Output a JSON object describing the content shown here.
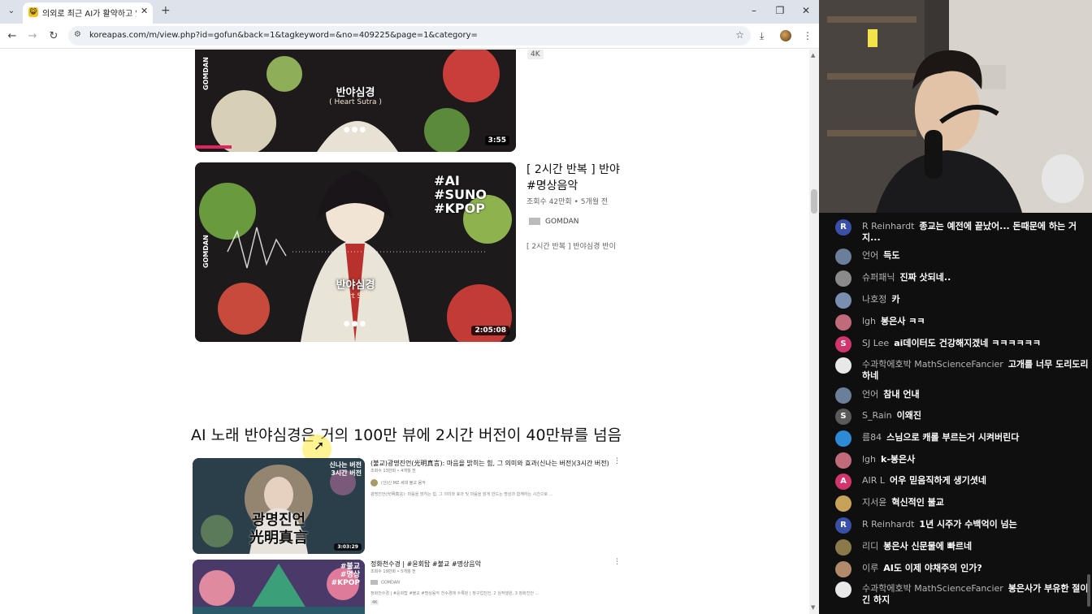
{
  "browser": {
    "tab_title": "의외로 최근 AI가 활약하고 있다",
    "url": "koreapas.com/m/view.php?id=gofun&back=1&tagkeyword=&no=409225&page=1&category="
  },
  "videos": [
    {
      "badge": "4K",
      "art_title": "반야심경",
      "art_sub": "( Heart Sutra )",
      "duration": "3:55"
    },
    {
      "art_title": "반야심경",
      "art_sub": "( Heart Sutra )",
      "hashtags": [
        "#AI",
        "#SUNO",
        "#KPOP"
      ],
      "duration": "2:05:08",
      "title_line1": "[ 2시간 반복 ] 반야",
      "title_line2": "#명상음악",
      "meta": "조회수 42만회 • 5개월 전",
      "channel": "GOMDAN",
      "desc": "[ 2시간 반복 ] 반야심경 반이"
    }
  ],
  "watermark": "GOMDAN",
  "headline": "AI 노래 반야심경은 거의 100만 뷰에 2시간 버전이 40만뷰를 넘음",
  "small_videos": [
    {
      "title": "(불교)광명진언(光明真言): 마음을 밝히는 힘, 그 의미와 효과(신나는 버전)(3시간 버전)",
      "meta": "조회수 13만회 • 4개월 전",
      "channel": "(신)신 MZ 세대 불교 음악",
      "desc": "광명진언(光明真言): 마음을 밝히는 힘, 그 의미와 효과 및 마음을 맑게 만드는 명상과 함께하는 시간으로 ...",
      "thumb_badge_line1": "신나는 버전",
      "thumb_badge_line2": "3시간 버전",
      "thumb_text_1": "광명진언",
      "thumb_text_2": "光明真言",
      "duration": "3:03:29"
    },
    {
      "title": "정화천수경 | #윤회탑 #불교 #명상음악",
      "meta": "조회수 19만회 • 5개월 전",
      "channel": "GOMDAN",
      "desc": "정화천수경 | #윤회탑 #불교 #명상음악 천수경에 수록된 | 정구업진언, 2 심적행원, 3 정화진언 ...",
      "badge": "4K",
      "thumb_tags": [
        "#불교",
        "#명상",
        "#KPOP"
      ]
    }
  ],
  "chat": [
    {
      "name": "R Reinhardt",
      "text": "종교는 예전에 끝났어... 돈때문에 하는 거지...",
      "av_color": "#3a4fa8",
      "av": "R"
    },
    {
      "name": "언어",
      "text": "득도",
      "av_color": "#6b7f9a",
      "av": ""
    },
    {
      "name": "슈퍼패닉",
      "text": "진짜 삿되네..",
      "av_color": "#8a8a8a",
      "av": ""
    },
    {
      "name": "나호정",
      "text": "카",
      "av_color": "#7a8fb0",
      "av": ""
    },
    {
      "name": "lgh",
      "text": "봉은사 ㅋㅋ",
      "av_color": "#c06a7a",
      "av": ""
    },
    {
      "name": "SJ Lee",
      "text": "ai데이터도 건강해지겠네 ㅋㅋㅋㅋㅋㅋ",
      "av_color": "#d2356b",
      "av": "S"
    },
    {
      "name": "수과학에호박 MathScienceFancier",
      "text": "고개를 너무 도리도리하네",
      "av_color": "#e8e8e8",
      "av": ""
    },
    {
      "name": "언어",
      "text": "참내 언내",
      "av_color": "#6b7f9a",
      "av": ""
    },
    {
      "name": "S_Rain",
      "text": "이왜진",
      "av_color": "#5a5a5a",
      "av": "S"
    },
    {
      "name": "름84",
      "text": "스님으로 캐롤 부르는거 시켜버린다",
      "av_color": "#2d8bd6",
      "av": ""
    },
    {
      "name": "lgh",
      "text": "k-봉은사",
      "av_color": "#c06a7a",
      "av": ""
    },
    {
      "name": "AIR L",
      "text": "어우 믿음직하게 생기셧네",
      "av_color": "#d2356b",
      "av": "A"
    },
    {
      "name": "지서윤",
      "text": "혁신적인 불교",
      "av_color": "#c9a25a",
      "av": ""
    },
    {
      "name": "R Reinhardt",
      "text": "1년 시주가 수백억이 넘는",
      "av_color": "#3a4fa8",
      "av": "R"
    },
    {
      "name": "리디",
      "text": "봉은사 신문물에 빠르네",
      "av_color": "#8a7a4a",
      "av": ""
    },
    {
      "name": "이루",
      "text": "AI도 이제 야채주의 인가?",
      "av_color": "#b08a6a",
      "av": ""
    },
    {
      "name": "수과학에호박 MathScienceFancier",
      "text": "봉은사가 부유한 절이긴 하지",
      "av_color": "#e8e8e8",
      "av": ""
    }
  ]
}
